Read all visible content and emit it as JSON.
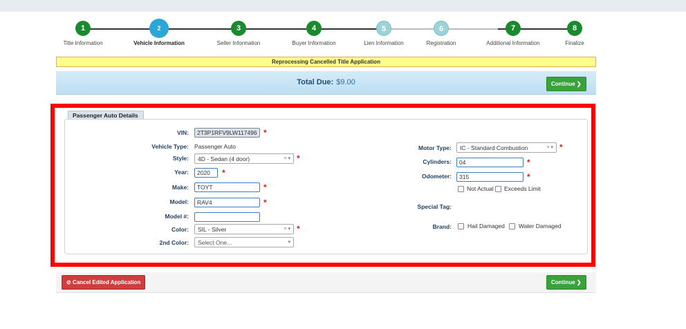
{
  "steps": [
    {
      "number": "1",
      "label": "Title Information",
      "state": "done"
    },
    {
      "number": "2",
      "label": "Vehicle Information",
      "state": "active"
    },
    {
      "number": "3",
      "label": "Seller Information",
      "state": "done"
    },
    {
      "number": "4",
      "label": "Buyer Information",
      "state": "done"
    },
    {
      "number": "5",
      "label": "Lien Information",
      "state": "light"
    },
    {
      "number": "6",
      "label": "Registration",
      "state": "light"
    },
    {
      "number": "7",
      "label": "Additional Information",
      "state": "done"
    },
    {
      "number": "8",
      "label": "Finalize",
      "state": "done"
    }
  ],
  "banner": "Reprocessing Cancelled Title Application",
  "total": {
    "label": "Total Due:",
    "amount": "$9.00"
  },
  "buttons": {
    "continue": "Continue",
    "cancel": "Cancel Edited Application"
  },
  "panel_title": "Passenger Auto Details",
  "fields": {
    "vin": {
      "label": "VIN:",
      "value": "2T3P1RFV9LW117496"
    },
    "vehicle_type": {
      "label": "Vehicle Type:",
      "value": "Passenger Auto"
    },
    "style": {
      "label": "Style:",
      "value": "4D - Sedan (4 door)"
    },
    "year": {
      "label": "Year:",
      "value": "2020"
    },
    "make": {
      "label": "Make:",
      "value": "TOYT"
    },
    "model": {
      "label": "Model:",
      "value": "RAV4"
    },
    "model_num": {
      "label": "Model #:",
      "value": ""
    },
    "color": {
      "label": "Color:",
      "value": "SIL - Silver"
    },
    "color2": {
      "label": "2nd Color:",
      "value": "Select One..."
    },
    "motor_type": {
      "label": "Motor Type:",
      "value": "IC - Standard Combustion"
    },
    "cylinders": {
      "label": "Cylinders:",
      "value": "04"
    },
    "odometer": {
      "label": "Odometer:",
      "value": "315"
    },
    "not_actual": "Not Actual",
    "exceeds_limit": "Exceeds Limit",
    "special_tag": {
      "label": "Special Tag:"
    },
    "brand": {
      "label": "Brand:"
    },
    "hail_damaged": "Hail Damaged",
    "water_damaged": "Water Damaged"
  },
  "select_controls": "× ▾",
  "required_mark": "*",
  "colors": {
    "highlight": "#ff0000",
    "active_step": "#2aa7d6",
    "done_step": "#1a8a2e",
    "banner_bg": "#fdfd8a"
  }
}
